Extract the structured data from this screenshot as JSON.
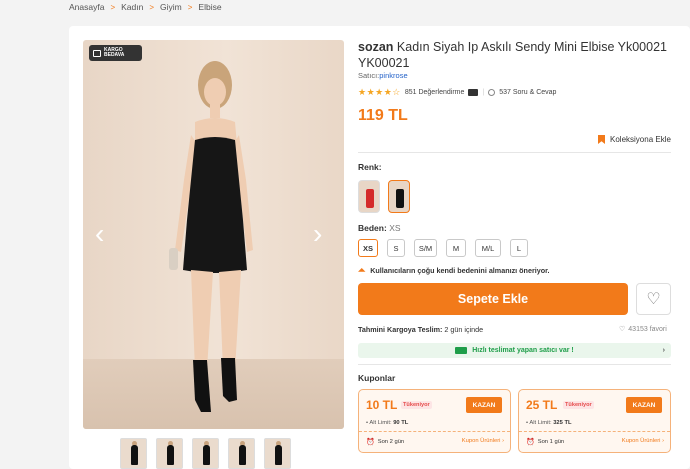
{
  "breadcrumb": [
    "Anasayfa",
    "Kadın",
    "Giyim",
    "Elbise"
  ],
  "gallery": {
    "badge_line1": "KARGO",
    "badge_line2": "BEDAVA",
    "prev": "‹",
    "next": "›",
    "thumb_count": 5
  },
  "product": {
    "brand": "sozan",
    "name": "Kadın Siyah Ip Askılı Sendy Mini Elbise Yk00021 YK00021",
    "seller_prefix": "Satıcı:",
    "seller": "pinkrose",
    "stars": "★★★★☆",
    "rating_value": 4.5,
    "reviews": "851 Değerlendirme",
    "qa": "537 Soru & Cevap",
    "price": "119 TL",
    "collection": "Koleksiyona Ekle"
  },
  "options": {
    "color_label": "Renk:",
    "size_label": "Beden:",
    "selected_size": "XS",
    "sizes": [
      "XS",
      "S",
      "S/M",
      "M",
      "M/L",
      "L"
    ],
    "size_hint": "Kullanıcıların çoğu kendi bedenini almanızı öneriyor."
  },
  "actions": {
    "add_to_cart": "Sepete Ekle",
    "fav_icon": "♡"
  },
  "delivery": {
    "prefix": "Tahmini Kargoya Teslim:",
    "value": "2 gün içinde",
    "favorites": "43153 favori",
    "fast": "Hızlı teslimat yapan satıcı var !"
  },
  "coupons": {
    "title": "Kuponlar",
    "items": [
      {
        "amount": "10 TL",
        "tag": "Tükeniyor",
        "button": "KAZAN",
        "limit_prefix": "Alt Limit:",
        "limit": "90 TL",
        "days": "Son 2 gün",
        "products": "Kupon Ürünleri"
      },
      {
        "amount": "25 TL",
        "tag": "Tükeniyor",
        "button": "KAZAN",
        "limit_prefix": "Alt Limit:",
        "limit": "325 TL",
        "days": "Son 1 gün",
        "products": "Kupon Ürünleri"
      }
    ]
  },
  "colors": {
    "accent": "#f27a1a",
    "green": "#1f9e4a",
    "link": "#2563c9"
  }
}
